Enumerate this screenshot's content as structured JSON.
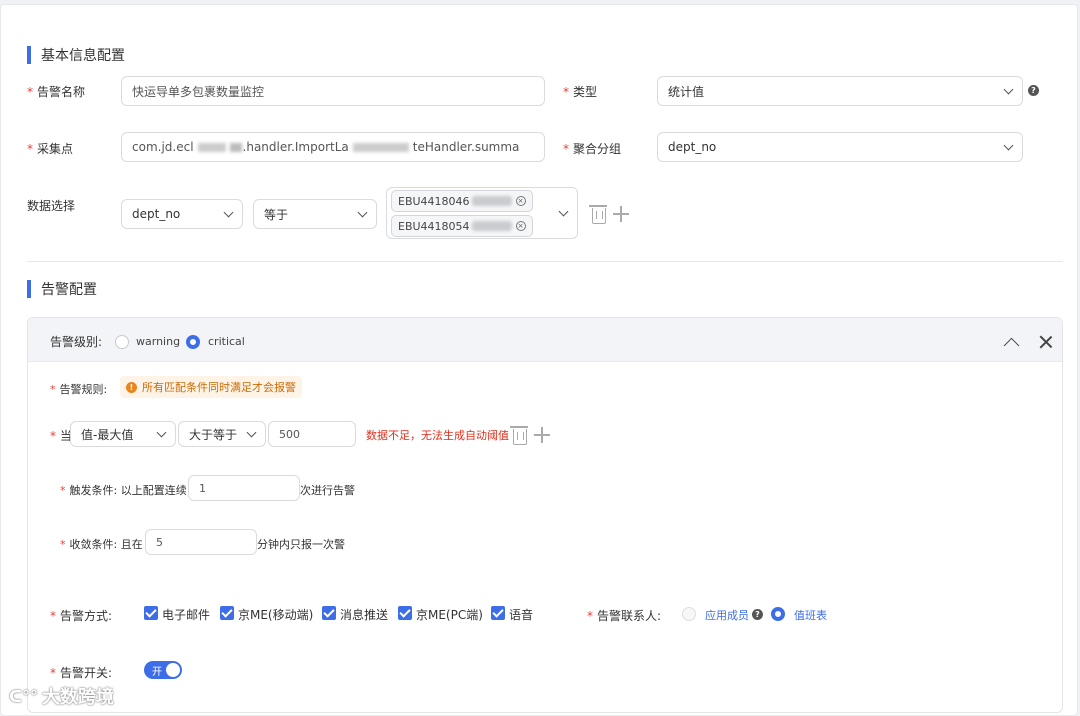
{
  "basic": {
    "section_title": "基本信息配置",
    "alert_name_label": "告警名称",
    "alert_name_value": "快运导单多包裹数量监控",
    "type_label": "类型",
    "type_value": "统计值",
    "collect_label": "采集点",
    "collect_value_a": "com.jd.ecl",
    "collect_value_b": ".handler.ImportLa",
    "collect_value_c": "teHandler.summa",
    "group_label": "聚合分组",
    "group_value": "dept_no",
    "data_label": "数据选择",
    "data_field": "dept_no",
    "data_op": "等于",
    "tags": [
      "EBU4418046",
      "EBU4418054"
    ]
  },
  "alert": {
    "section_title": "告警配置",
    "level_label": "告警级别:",
    "level_options": [
      "warning",
      "critical"
    ],
    "level_selected": "critical",
    "rule_label": "告警规则:",
    "rule_hint": "所有匹配条件同时满足才会报警",
    "when_label": "当",
    "metric": "值-最大值",
    "comparator": "大于等于",
    "threshold": "500",
    "threshold_error": "数据不足，无法生成自动阈值",
    "trigger_label": "触发条件:",
    "trigger_prefix": "以上配置连续",
    "trigger_value": "1",
    "trigger_suffix": "次进行告警",
    "converge_label": "收敛条件:",
    "converge_prefix": "且在",
    "converge_value": "5",
    "converge_suffix": "分钟内只报一次警",
    "method_label": "告警方式:",
    "methods": [
      "电子邮件",
      "京ME(移动端)",
      "消息推送",
      "京ME(PC端)",
      "语音"
    ],
    "contact_label": "告警联系人:",
    "contact_options": [
      "应用成员",
      "值班表"
    ],
    "contact_selected": "值班表",
    "switch_label": "告警开关:",
    "switch_text": "开"
  },
  "watermark": "大数跨境"
}
